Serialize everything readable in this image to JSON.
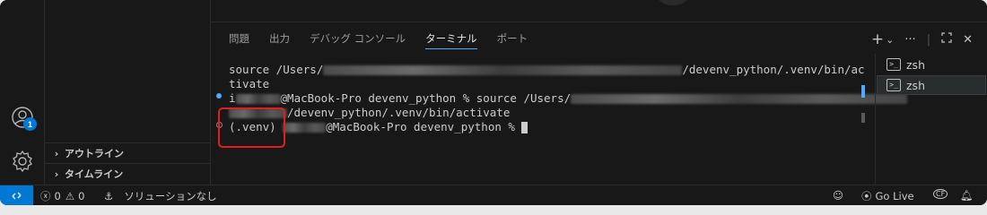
{
  "panel": {
    "tabs": [
      {
        "label": "問題"
      },
      {
        "label": "出力"
      },
      {
        "label": "デバッグ コンソール"
      },
      {
        "label": "ターミナル"
      },
      {
        "label": "ポート"
      }
    ],
    "active_tab": "ターミナル",
    "actions": {
      "add": "+",
      "dropdown": "⌄",
      "more": "···",
      "maximize": "⛶",
      "close": "✕"
    }
  },
  "sidebar": {
    "sections": [
      {
        "label": "アウトライン"
      },
      {
        "label": "タイムライン"
      }
    ]
  },
  "activity": {
    "accounts_badge": "1"
  },
  "terminal": {
    "line1_a": "source /Users/",
    "line1_b": "/devenv_python/.venv/bin/ac",
    "line2": "tivate",
    "line3_a": "i",
    "line3_b": "@MacBook-Pro devenv_python % source /Users/",
    "line4_b": "/devenv_python/.venv/bin/activate",
    "line5_a": "(.venv) ",
    "line5_b": "@MacBook-Pro devenv_python % "
  },
  "terminal_list": {
    "items": [
      {
        "label": "zsh"
      },
      {
        "label": "zsh"
      }
    ]
  },
  "statusbar": {
    "errors": "0",
    "warnings": "0",
    "solution": "ソリューションなし",
    "go_live": "Go Live"
  },
  "colors": {
    "accent": "#0078d4",
    "highlight_box": "#e02020",
    "tab_underline": "#4daafc"
  }
}
